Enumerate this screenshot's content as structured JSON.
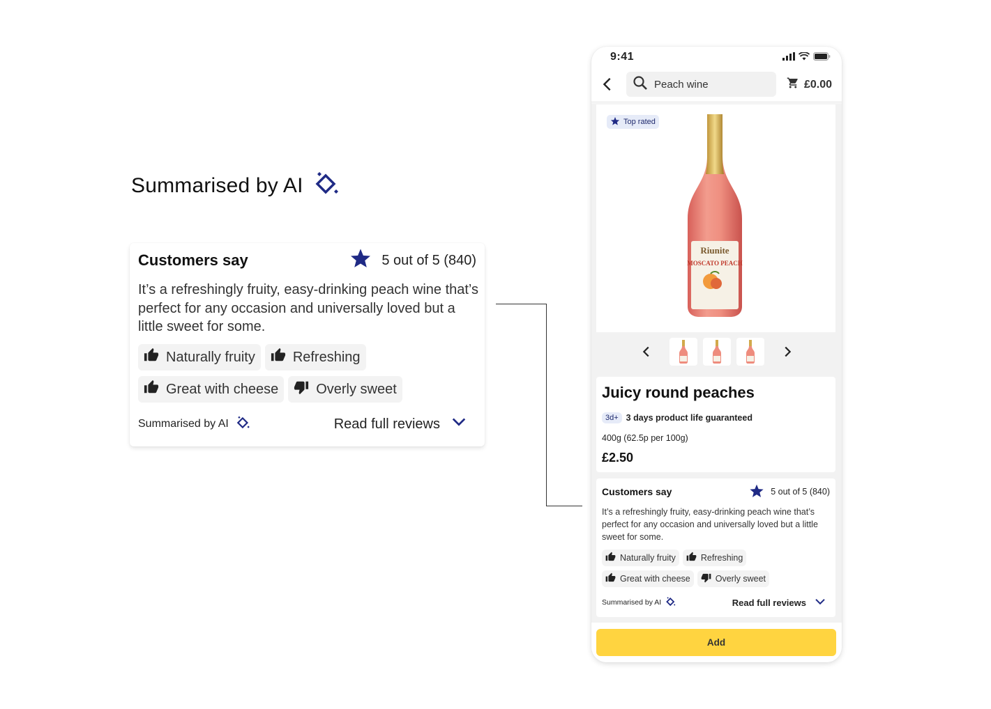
{
  "colors": {
    "brand_navy": "#1f2a85",
    "add_button": "#ffd440",
    "chip_bg": "#f3f3f3",
    "badge_bg": "#e6ebf8"
  },
  "hero": {
    "title": "Summarised by AI",
    "icon": "ai-sparkle-icon"
  },
  "review_card": {
    "title": "Customers say",
    "rating_icon": "star-icon",
    "rating_text": "5 out of 5 (840)",
    "summary": "It’s a refreshingly fruity, easy-drinking peach wine that’s perfect for any occasion and universally loved but a little sweet for some.",
    "chips": [
      {
        "label": "Naturally fruity",
        "icon": "thumbs-up-icon"
      },
      {
        "label": "Refreshing",
        "icon": "thumbs-up-icon"
      },
      {
        "label": "Great with cheese",
        "icon": "thumbs-up-icon"
      },
      {
        "label": "Overly sweet",
        "icon": "thumbs-down-icon"
      }
    ],
    "ai_label": "Summarised by AI",
    "read_more": "Read full reviews"
  },
  "phone": {
    "status_time": "9:41",
    "search_query": "Peach wine",
    "cart_total": "£0.00",
    "badge": "Top rated",
    "bottle_brand": "Riunite",
    "bottle_variety": "MOSCATO PEACH",
    "product": {
      "name": "Juicy round peaches",
      "life_tag": "3d+",
      "life_text": "3 days product life guaranteed",
      "weight": "400g (62.5p per 100g)",
      "price": "£2.50"
    },
    "add_label": "Add"
  }
}
